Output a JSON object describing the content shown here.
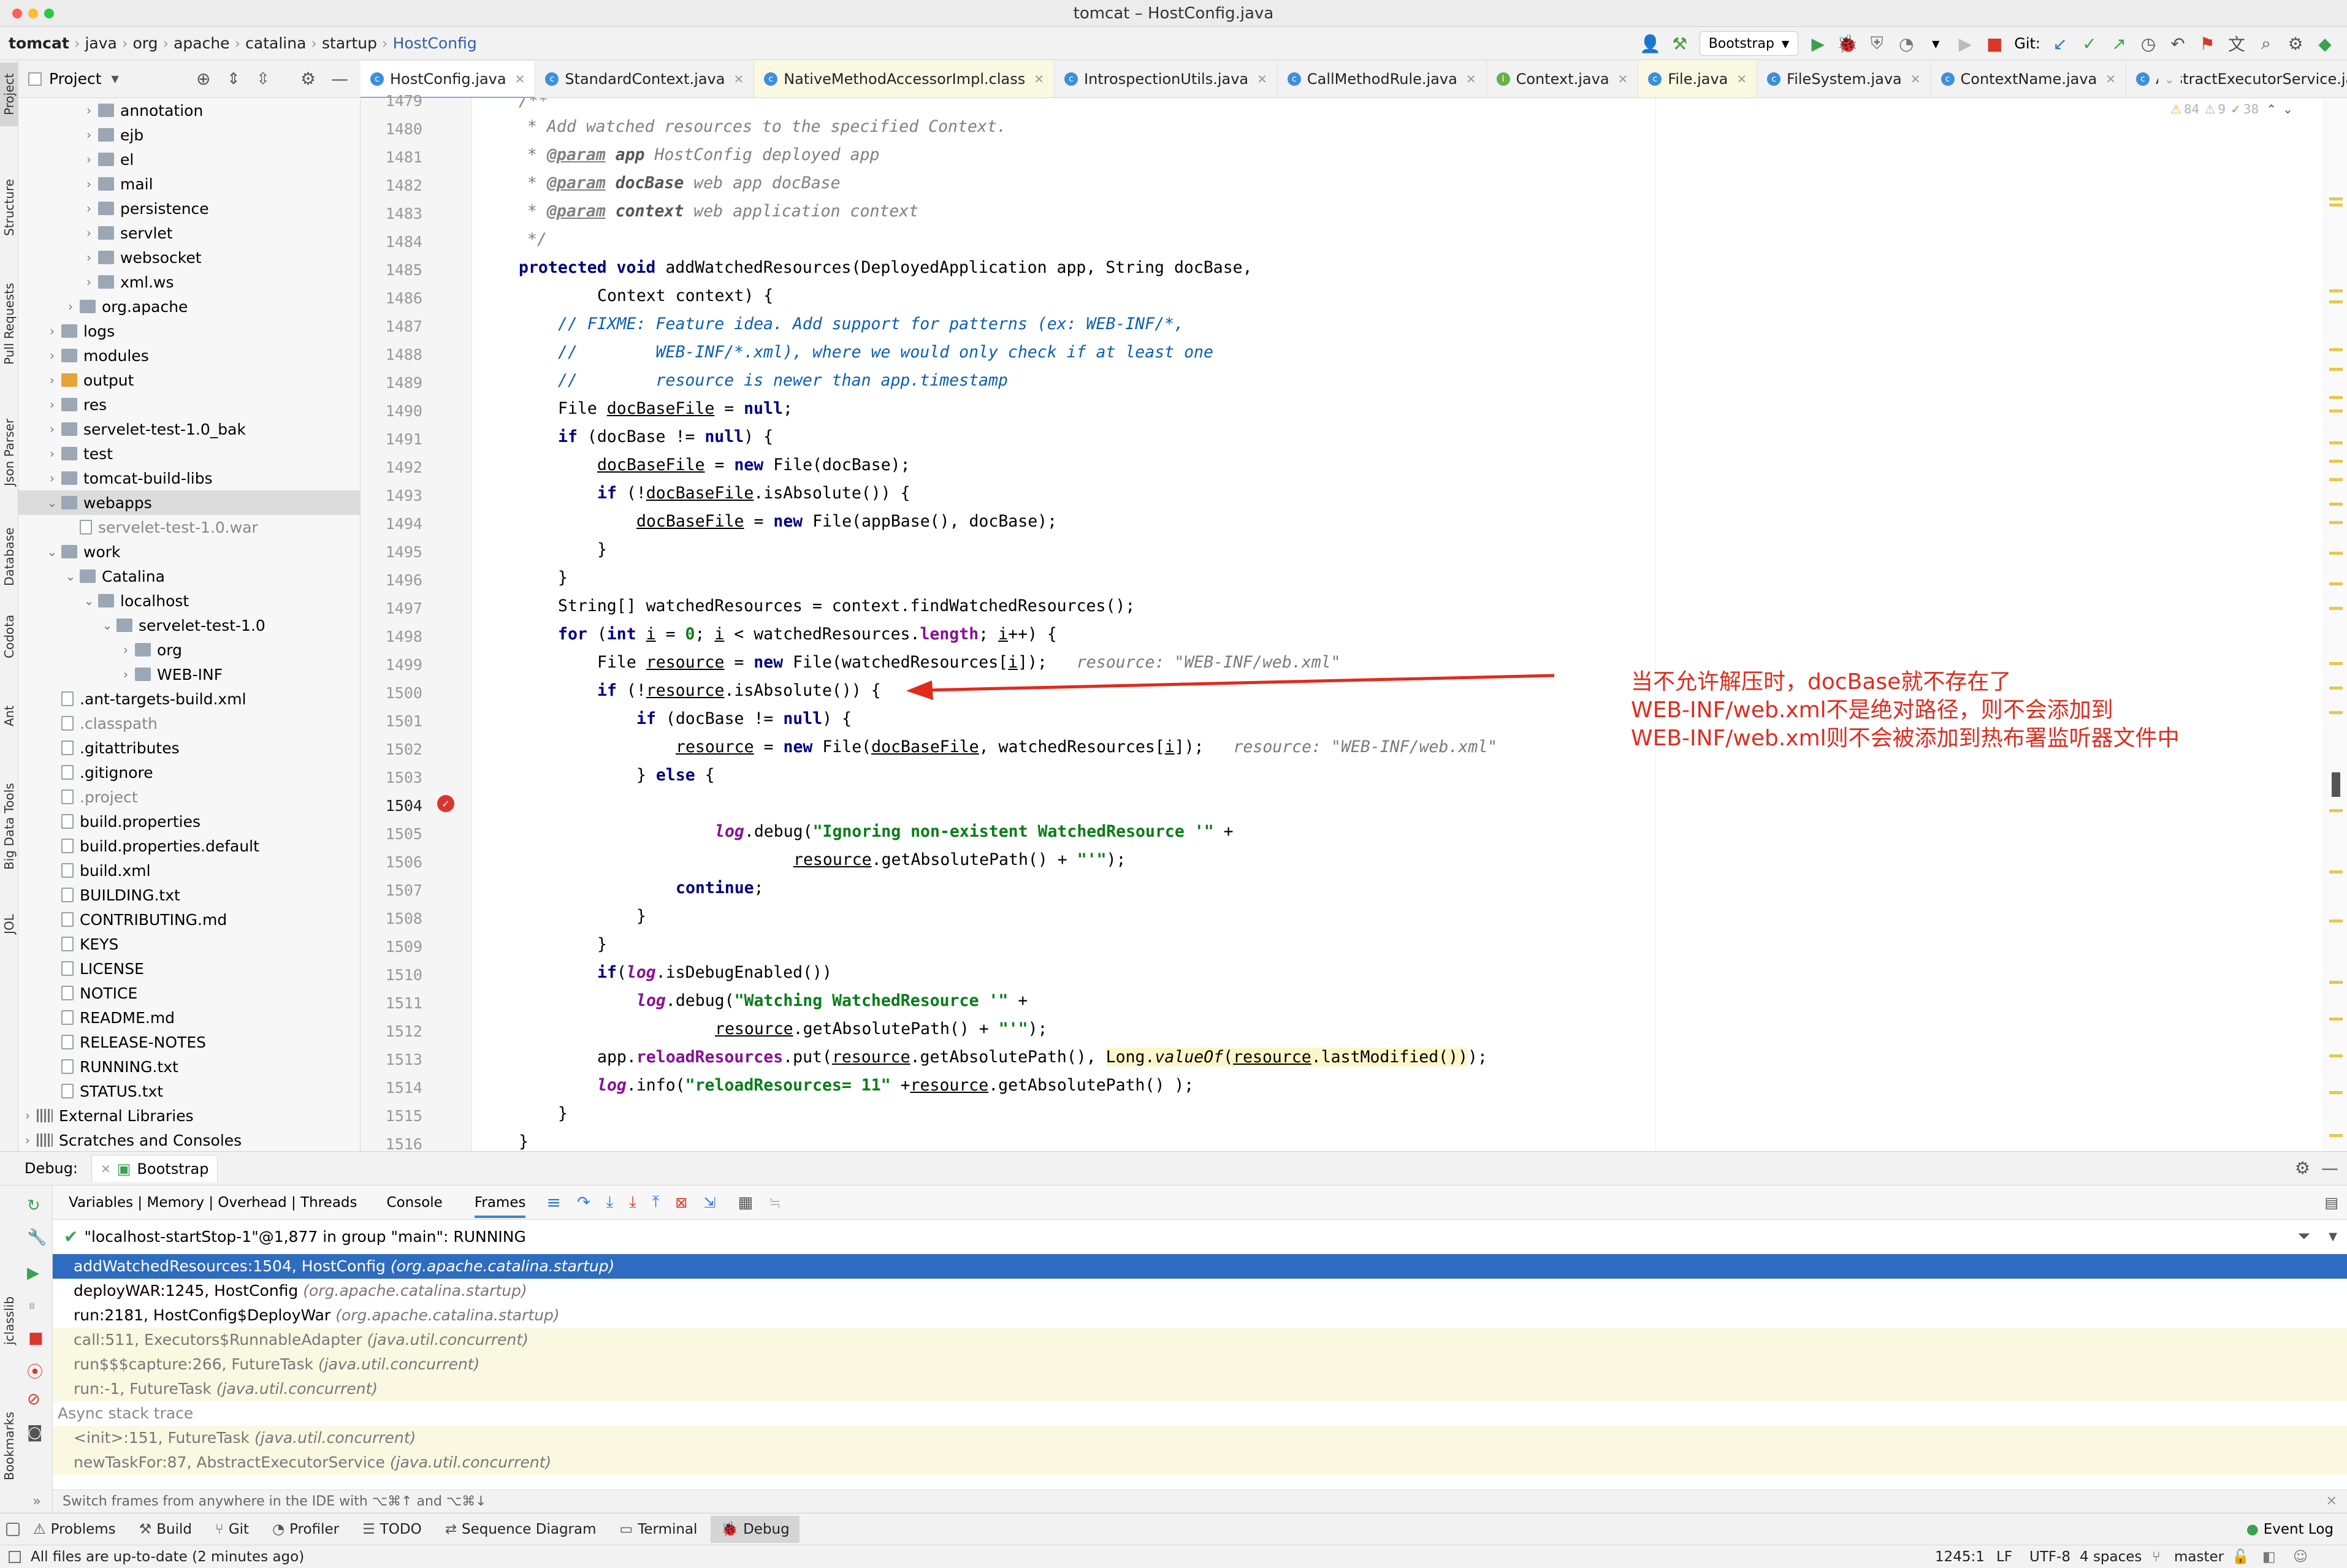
{
  "window": {
    "title": "tomcat – HostConfig.java"
  },
  "breadcrumb": [
    "tomcat",
    "java",
    "org",
    "apache",
    "catalina",
    "startup",
    "HostConfig"
  ],
  "toolbar": {
    "run_config": "Bootstrap",
    "git_label": "Git:"
  },
  "project_panel": {
    "title": "Project"
  },
  "tree": [
    {
      "label": "annotation",
      "indent": 5,
      "kind": "folder",
      "arrow": "›"
    },
    {
      "label": "ejb",
      "indent": 5,
      "kind": "folder",
      "arrow": "›"
    },
    {
      "label": "el",
      "indent": 5,
      "kind": "folder",
      "arrow": "›"
    },
    {
      "label": "mail",
      "indent": 5,
      "kind": "folder",
      "arrow": "›"
    },
    {
      "label": "persistence",
      "indent": 5,
      "kind": "folder",
      "arrow": "›"
    },
    {
      "label": "servlet",
      "indent": 5,
      "kind": "folder",
      "arrow": "›"
    },
    {
      "label": "websocket",
      "indent": 5,
      "kind": "folder",
      "arrow": "›"
    },
    {
      "label": "xml.ws",
      "indent": 5,
      "kind": "folder",
      "arrow": "›"
    },
    {
      "label": "org.apache",
      "indent": 4,
      "kind": "folder",
      "arrow": "›"
    },
    {
      "label": "logs",
      "indent": 3,
      "kind": "folder",
      "arrow": "›"
    },
    {
      "label": "modules",
      "indent": 3,
      "kind": "folder",
      "arrow": "›"
    },
    {
      "label": "output",
      "indent": 3,
      "kind": "folder-orange",
      "arrow": "›"
    },
    {
      "label": "res",
      "indent": 3,
      "kind": "folder",
      "arrow": "›"
    },
    {
      "label": "servelet-test-1.0_bak",
      "indent": 3,
      "kind": "folder",
      "arrow": "›"
    },
    {
      "label": "test",
      "indent": 3,
      "kind": "folder",
      "arrow": "›"
    },
    {
      "label": "tomcat-build-libs",
      "indent": 3,
      "kind": "folder",
      "arrow": "›"
    },
    {
      "label": "webapps",
      "indent": 3,
      "kind": "folder",
      "arrow": "⌄",
      "selected": true
    },
    {
      "label": "servelet-test-1.0.war",
      "indent": 4,
      "kind": "file",
      "arrow": "",
      "muted": true
    },
    {
      "label": "work",
      "indent": 3,
      "kind": "folder",
      "arrow": "⌄"
    },
    {
      "label": "Catalina",
      "indent": 4,
      "kind": "folder",
      "arrow": "⌄"
    },
    {
      "label": "localhost",
      "indent": 5,
      "kind": "folder",
      "arrow": "⌄"
    },
    {
      "label": "servelet-test-1.0",
      "indent": 6,
      "kind": "folder",
      "arrow": "⌄"
    },
    {
      "label": "org",
      "indent": 7,
      "kind": "folder",
      "arrow": "›"
    },
    {
      "label": "WEB-INF",
      "indent": 7,
      "kind": "folder",
      "arrow": "›"
    },
    {
      "label": ".ant-targets-build.xml",
      "indent": 3,
      "kind": "file",
      "arrow": ""
    },
    {
      "label": ".classpath",
      "indent": 3,
      "kind": "file",
      "arrow": "",
      "muted": true
    },
    {
      "label": ".gitattributes",
      "indent": 3,
      "kind": "file",
      "arrow": ""
    },
    {
      "label": ".gitignore",
      "indent": 3,
      "kind": "file",
      "arrow": ""
    },
    {
      "label": ".project",
      "indent": 3,
      "kind": "file",
      "arrow": "",
      "muted": true
    },
    {
      "label": "build.properties",
      "indent": 3,
      "kind": "file",
      "arrow": ""
    },
    {
      "label": "build.properties.default",
      "indent": 3,
      "kind": "file",
      "arrow": ""
    },
    {
      "label": "build.xml",
      "indent": 3,
      "kind": "file",
      "arrow": ""
    },
    {
      "label": "BUILDING.txt",
      "indent": 3,
      "kind": "file",
      "arrow": ""
    },
    {
      "label": "CONTRIBUTING.md",
      "indent": 3,
      "kind": "file",
      "arrow": ""
    },
    {
      "label": "KEYS",
      "indent": 3,
      "kind": "file",
      "arrow": ""
    },
    {
      "label": "LICENSE",
      "indent": 3,
      "kind": "file",
      "arrow": ""
    },
    {
      "label": "NOTICE",
      "indent": 3,
      "kind": "file",
      "arrow": ""
    },
    {
      "label": "README.md",
      "indent": 3,
      "kind": "file",
      "arrow": ""
    },
    {
      "label": "RELEASE-NOTES",
      "indent": 3,
      "kind": "file",
      "arrow": ""
    },
    {
      "label": "RUNNING.txt",
      "indent": 3,
      "kind": "file",
      "arrow": ""
    },
    {
      "label": "STATUS.txt",
      "indent": 3,
      "kind": "file",
      "arrow": ""
    },
    {
      "label": "External Libraries",
      "indent": 1,
      "kind": "lib",
      "arrow": "›"
    },
    {
      "label": "Scratches and Consoles",
      "indent": 1,
      "kind": "lib",
      "arrow": "›"
    }
  ],
  "editor_tabs": [
    {
      "label": "HostConfig.java",
      "active": true
    },
    {
      "label": "StandardContext.java"
    },
    {
      "label": "NativeMethodAccessorImpl.class"
    },
    {
      "label": "IntrospectionUtils.java"
    },
    {
      "label": "CallMethodRule.java"
    },
    {
      "label": "Context.java"
    },
    {
      "label": "File.java"
    },
    {
      "label": "FileSystem.java"
    },
    {
      "label": "ContextName.java"
    },
    {
      "label": "AbstractExecutorService.java"
    }
  ],
  "inspection": {
    "warnings": "84",
    "weak": "9",
    "typos": "38"
  },
  "code": {
    "line_numbers": [
      "1479",
      "1480",
      "1481",
      "1482",
      "1483",
      "1484",
      "1485",
      "1486",
      "1487",
      "1488",
      "1489",
      "1490",
      "1491",
      "1492",
      "1493",
      "1494",
      "1495",
      "1496",
      "1497",
      "1498",
      "1499",
      "1500",
      "1501",
      "1502",
      "1503",
      "1504",
      "1505",
      "1506",
      "1507",
      "1508",
      "1509",
      "1510",
      "1511",
      "1512",
      "1513",
      "1514",
      "1515",
      "1516"
    ],
    "current_line": "1504",
    "inline_hint_1499": "resource: \"WEB-INF/web.xml\"",
    "inline_hint_1502": "resource: \"WEB-INF/web.xml\""
  },
  "annotation": {
    "line1": "当不允许解压时，docBase就不存在了",
    "line2": "WEB-INF/web.xml不是绝对路径，则不会添加到",
    "line3": "WEB-INF/web.xml则不会被添加到热布署监听器文件中",
    "color": "#e02b1e"
  },
  "debug": {
    "label": "Debug:",
    "session": "Bootstrap",
    "tabs": [
      "Variables | Memory | Overhead | Threads",
      "Console",
      "Frames"
    ],
    "thread": "\"localhost-startStop-1\"@1,877 in group \"main\": RUNNING",
    "frames": [
      {
        "method": "addWatchedResources:1504, HostConfig",
        "pkg": "(org.apache.catalina.startup)",
        "state": "sel"
      },
      {
        "method": "deployWAR:1245, HostConfig",
        "pkg": "(org.apache.catalina.startup)",
        "state": ""
      },
      {
        "method": "run:2181, HostConfig$DeployWar",
        "pkg": "(org.apache.catalina.startup)",
        "state": ""
      },
      {
        "method": "call:511, Executors$RunnableAdapter",
        "pkg": "(java.util.concurrent)",
        "state": "lib"
      },
      {
        "method": "run$$$capture:266, FutureTask",
        "pkg": "(java.util.concurrent)",
        "state": "lib"
      },
      {
        "method": "run:-1, FutureTask",
        "pkg": "(java.util.concurrent)",
        "state": "lib"
      }
    ],
    "async_label": "Async stack trace",
    "async_frames": [
      {
        "method": "<init>:151, FutureTask",
        "pkg": "(java.util.concurrent)"
      },
      {
        "method": "newTaskFor:87, AbstractExecutorService",
        "pkg": "(java.util.concurrent)"
      }
    ],
    "hint": "Switch frames from anywhere in the IDE with ⌥⌘↑ and ⌥⌘↓"
  },
  "tool_tabs": [
    "Problems",
    "Build",
    "Git",
    "Profiler",
    "TODO",
    "Sequence Diagram",
    "Terminal",
    "Debug"
  ],
  "tool_active": "Debug",
  "event_log": "Event Log",
  "left_strip": [
    "Project",
    "Structure",
    "Pull Requests",
    "Json Parser",
    "Database",
    "Codota",
    "Ant",
    "Big Data Tools",
    "JOL"
  ],
  "debug_strip": [
    "jclasslib",
    "Bookmarks"
  ],
  "status": {
    "message": "All files are up-to-date (2 minutes ago)",
    "position": "1245:1",
    "line_sep": "LF",
    "encoding": "UTF-8",
    "indent": "4 spaces",
    "branch": "master"
  },
  "colors": {
    "accent": "#2d6cc0",
    "current_line": "#2d5ea8",
    "keyword": "#000080",
    "string": "#067d17"
  }
}
